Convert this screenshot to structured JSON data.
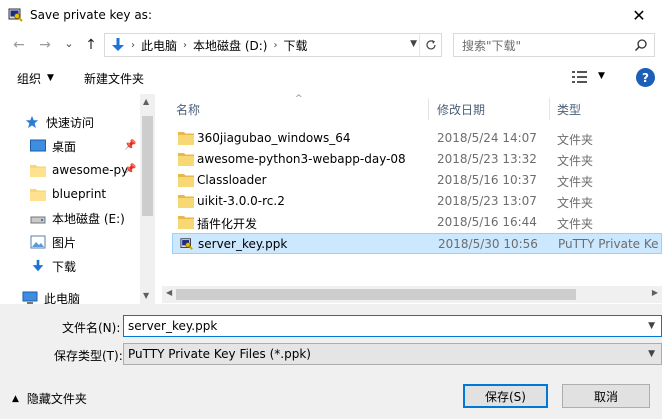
{
  "window": {
    "title": "Save private key as:",
    "close_glyph": "✕"
  },
  "nav": {
    "back_glyph": "←",
    "forward_glyph": "→",
    "dropdown_glyph": "⌄",
    "up_glyph": "↑",
    "breadcrumb": [
      "此电脑",
      "本地磁盘 (D:)",
      "下载"
    ],
    "search_placeholder": "搜索\"下载\""
  },
  "toolbar": {
    "organize_label": "组织",
    "new_folder_label": "新建文件夹",
    "help_glyph": "?"
  },
  "sidebar": {
    "items": [
      {
        "label": "快速访问",
        "icon": "star-icon",
        "pinned": false
      },
      {
        "label": "桌面",
        "icon": "desktop-icon",
        "pinned": true
      },
      {
        "label": "awesome-py",
        "icon": "folder-icon",
        "pinned": true
      },
      {
        "label": "blueprint",
        "icon": "folder-icon",
        "pinned": false
      },
      {
        "label": "本地磁盘 (E:)",
        "icon": "drive-icon",
        "pinned": false
      },
      {
        "label": "图片",
        "icon": "pictures-icon",
        "pinned": false
      },
      {
        "label": "下载",
        "icon": "download-icon",
        "pinned": false
      },
      {
        "label": "此电脑",
        "icon": "computer-icon",
        "pinned": false
      }
    ]
  },
  "files": {
    "columns": {
      "name": "名称",
      "date": "修改日期",
      "type": "类型"
    },
    "rows": [
      {
        "name": "360jiagubao_windows_64",
        "date": "2018/5/24 14:07",
        "type": "文件夹",
        "icon": "folder-icon",
        "selected": false
      },
      {
        "name": "awesome-python3-webapp-day-08",
        "date": "2018/5/23 13:32",
        "type": "文件夹",
        "icon": "folder-icon",
        "selected": false
      },
      {
        "name": "Classloader",
        "date": "2018/5/16 10:37",
        "type": "文件夹",
        "icon": "folder-icon",
        "selected": false
      },
      {
        "name": "uikit-3.0.0-rc.2",
        "date": "2018/5/23 13:07",
        "type": "文件夹",
        "icon": "folder-icon",
        "selected": false
      },
      {
        "name": "插件化开发",
        "date": "2018/5/16 16:44",
        "type": "文件夹",
        "icon": "folder-icon",
        "selected": false
      },
      {
        "name": "server_key.ppk",
        "date": "2018/5/30 10:56",
        "type": "PuTTY Private Ke",
        "icon": "putty-key-icon",
        "selected": true
      }
    ]
  },
  "form": {
    "filename_label": "文件名(N):",
    "filename_value": "server_key.ppk",
    "filetype_label": "保存类型(T):",
    "filetype_value": "PuTTY Private Key Files (*.ppk)",
    "hide_folders_label": "隐藏文件夹",
    "save_label": "保存(S)",
    "cancel_label": "取消"
  },
  "colors": {
    "accent": "#0078d7",
    "selection": "#cce8ff",
    "folder": "#f8d775"
  }
}
